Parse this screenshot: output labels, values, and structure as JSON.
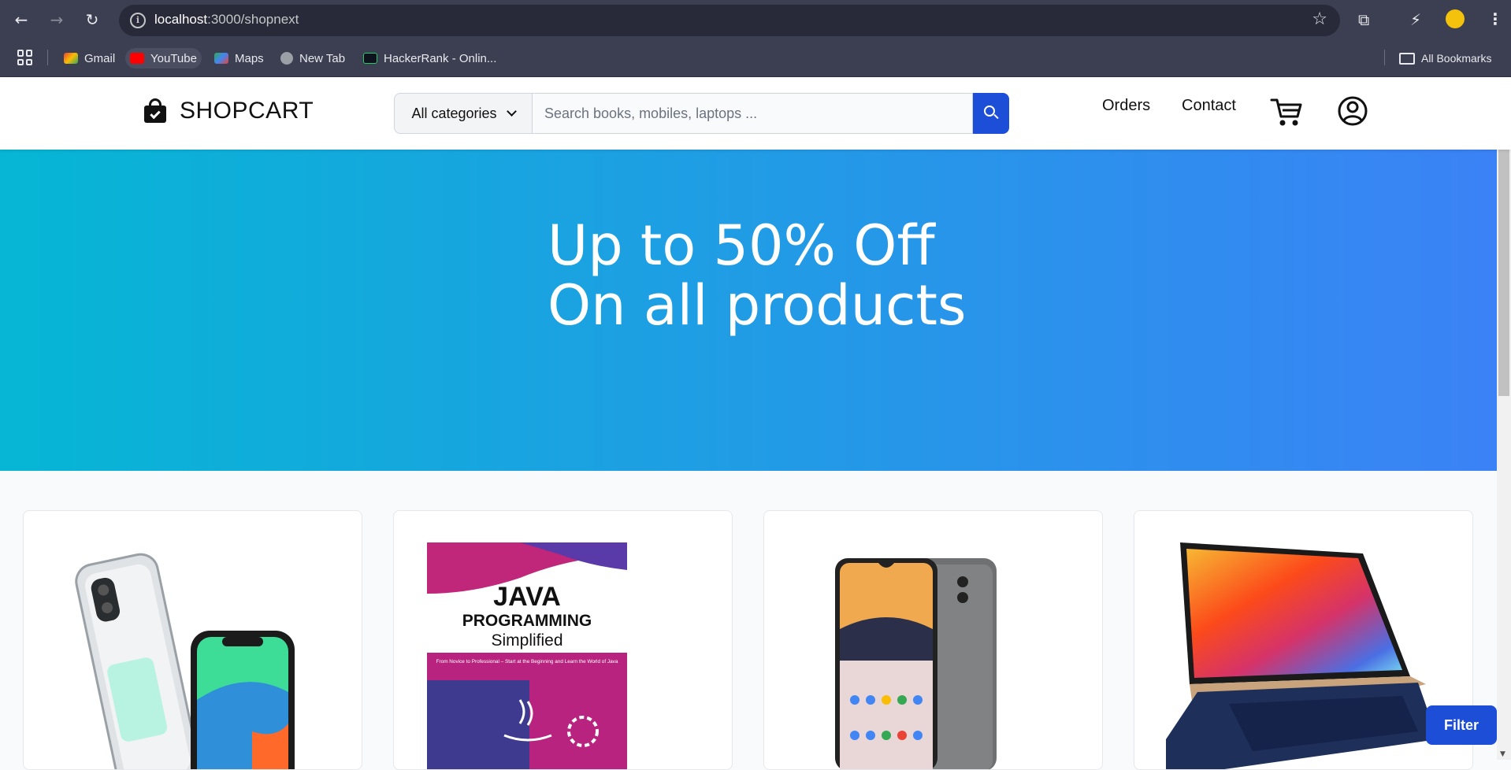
{
  "browser": {
    "url_host": "localhost",
    "url_path": ":3000/shopnext",
    "bookmarks": [
      {
        "label": "Gmail",
        "icon": "gmail-icon"
      },
      {
        "label": "YouTube",
        "icon": "youtube-icon"
      },
      {
        "label": "Maps",
        "icon": "maps-icon"
      },
      {
        "label": "New Tab",
        "icon": "globe-icon"
      },
      {
        "label": "HackerRank - Onlin...",
        "icon": "hackerrank-icon"
      }
    ],
    "all_bookmarks": "All Bookmarks"
  },
  "header": {
    "brand": "SHOPCART",
    "category_select": "All categories",
    "search_placeholder": "Search books, mobiles, laptops ...",
    "nav": {
      "orders": "Orders",
      "contact": "Contact"
    }
  },
  "hero": {
    "line1": "Up to 50% Off",
    "line2": "On all products",
    "gradient_from": "#06b6d4",
    "gradient_to": "#3b82f6"
  },
  "products": [
    {
      "image": "iphone-image"
    },
    {
      "image": "java-book-image",
      "book_title": "JAVA",
      "book_subtitle": "PROGRAMMING",
      "book_tag": "Simplified",
      "book_blurb": "From Novice to Professional – Start at the Beginning and Learn the World of Java"
    },
    {
      "image": "nokia-phone-image"
    },
    {
      "image": "laptop-image"
    }
  ],
  "filter_button": "Filter",
  "accent_color": "#1d4ed8"
}
